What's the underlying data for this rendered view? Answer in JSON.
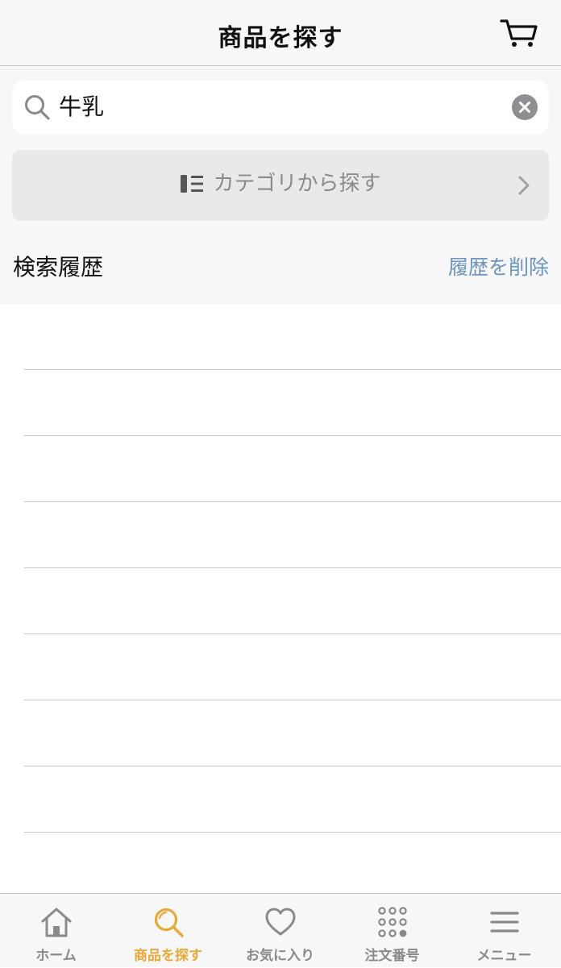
{
  "header": {
    "title": "商品を探す",
    "cart_icon": "cart-icon"
  },
  "search": {
    "value": "牛乳",
    "search_icon": "search-icon",
    "clear_icon": "clear-icon"
  },
  "category": {
    "label": "カテゴリから探す",
    "icon": "category-list-icon",
    "chevron": "chevron-right-icon"
  },
  "history": {
    "title": "検索履歴",
    "clear_label": "履歴を削除",
    "rows": [
      "",
      "",
      "",
      "",
      "",
      "",
      "",
      "",
      ""
    ]
  },
  "tabbar": {
    "active_color": "#e8a93a",
    "inactive_color": "#8a8a8a",
    "tabs": [
      {
        "label": "ホーム",
        "icon": "home-icon",
        "active": false
      },
      {
        "label": "商品を探す",
        "icon": "search-icon",
        "active": true
      },
      {
        "label": "お気に入り",
        "icon": "heart-icon",
        "active": false
      },
      {
        "label": "注文番号",
        "icon": "keypad-icon",
        "active": false
      },
      {
        "label": "メニュー",
        "icon": "menu-icon",
        "active": false
      }
    ]
  }
}
